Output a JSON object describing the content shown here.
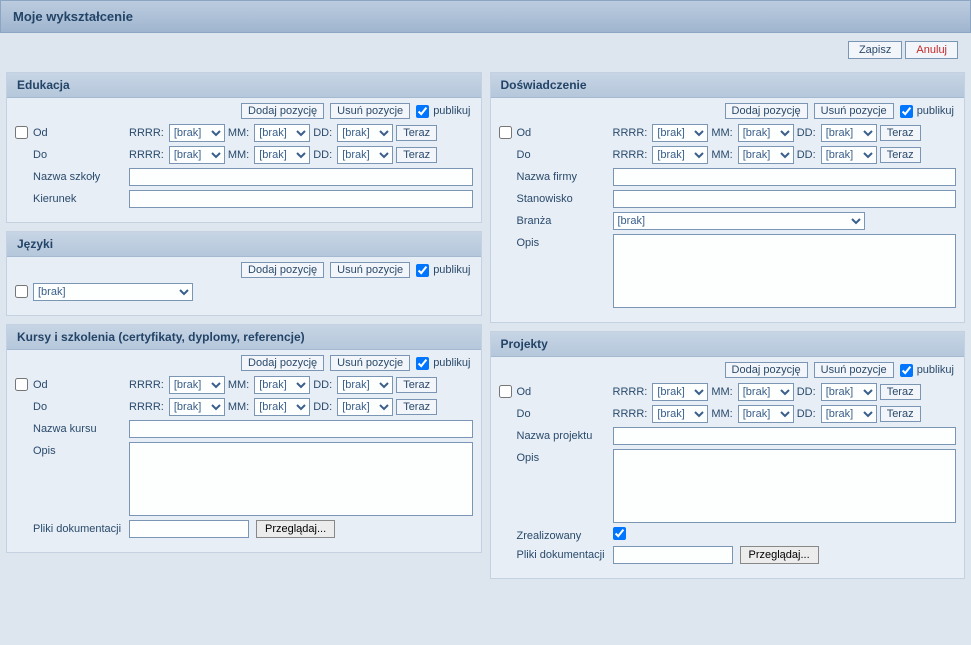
{
  "title": "Moje wykształcenie",
  "actions": {
    "save": "Zapisz",
    "cancel": "Anuluj"
  },
  "common": {
    "add": "Dodaj pozycję",
    "remove": "Usuń pozycje",
    "publish": "publikuj",
    "now": "Teraz",
    "browse": "Przeglądaj...",
    "brak_option": "[brak]",
    "date": {
      "yyyy": "RRRR:",
      "mm": "MM:",
      "dd": "DD:"
    },
    "od": "Od",
    "do": "Do",
    "opis": "Opis",
    "pliki": "Pliki dokumentacji"
  },
  "panels": {
    "edukacja": {
      "title": "Edukacja",
      "fields": {
        "nazwa_szkoly": "Nazwa szkoły",
        "kierunek": "Kierunek"
      }
    },
    "jezyki": {
      "title": "Języki"
    },
    "doswiadczenie": {
      "title": "Doświadczenie",
      "fields": {
        "nazwa_firmy": "Nazwa firmy",
        "stanowisko": "Stanowisko",
        "branza": "Branża"
      }
    },
    "kursy": {
      "title": "Kursy i szkolenia (certyfikaty, dyplomy, referencje)",
      "fields": {
        "nazwa_kursu": "Nazwa kursu"
      }
    },
    "projekty": {
      "title": "Projekty",
      "fields": {
        "nazwa_projektu": "Nazwa projektu",
        "zrealizowany": "Zrealizowany"
      }
    }
  }
}
